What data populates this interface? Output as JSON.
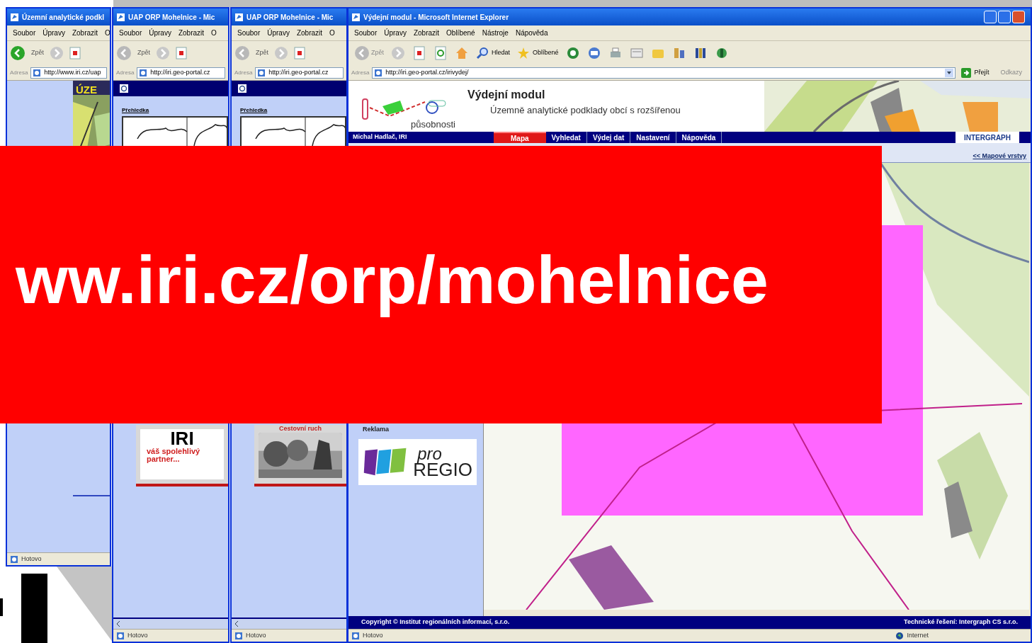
{
  "banner": {
    "text": "ww.iri.cz/orp/mohelnice"
  },
  "windows": [
    {
      "kind": "image_page",
      "image_text": "ÚZE",
      "title": "Územní analytické podkl",
      "menu": [
        "Soubor",
        "Úpravy",
        "Zobrazit",
        "O"
      ],
      "back": "Zpět",
      "address_label": "Adresa",
      "url": "http://www.iri.cz/uap",
      "status": "Hotovo"
    },
    {
      "kind": "overview",
      "title": "UAP ORP Mohelnice - Mic",
      "menu": [
        "Soubor",
        "Úpravy",
        "Zobrazit",
        "O"
      ],
      "back": "Zpět",
      "address_label": "Adresa",
      "url": "http://iri.geo-portal.cz",
      "status": "Hotovo",
      "section": "Přehledka",
      "card": {
        "kind": "logo",
        "brand": "IRI",
        "tagline": "váš spolehlivý partner..."
      }
    },
    {
      "kind": "overview",
      "title": "UAP ORP Mohelnice - Mic",
      "menu": [
        "Soubor",
        "Úpravy",
        "Zobrazit",
        "O"
      ],
      "back": "Zpět",
      "address_label": "Adresa",
      "url": "http://iri.geo-portal.cz",
      "status": "Hotovo",
      "section": "Přehledka",
      "card": {
        "caption": "Cestovní ruch"
      }
    }
  ],
  "main": {
    "title": "Výdejní modul - Microsoft Internet Explorer",
    "menu": [
      "Soubor",
      "Úpravy",
      "Zobrazit",
      "Oblíbené",
      "Nástroje",
      "Nápověda"
    ],
    "back": "Zpět",
    "search": "Hledat",
    "favorites": "Oblíbené",
    "address_label": "Adresa",
    "url": "http://iri.geo-portal.cz/irivydej/",
    "go": "Přejít",
    "links": "Odkazy",
    "header": {
      "title": "Výdejní modul",
      "subtitle": "Územně analytické podklady obcí s rozšířenou",
      "subtitle_2": "působnosti"
    },
    "user": "Michal Hadlač, IRI",
    "tabs": [
      {
        "label": "Mapa",
        "selected": true
      },
      {
        "label": "Vyhledat",
        "selected": false
      },
      {
        "label": "Výdej dat",
        "selected": false
      },
      {
        "label": "Nastavení",
        "selected": false
      },
      {
        "label": "Nápověda",
        "selected": false
      }
    ],
    "partner": "INTERGRAPH",
    "layers_link": "<< Mapové vrstvy",
    "sidebar_heading": "Reklama",
    "ad": {
      "line_1": "pro",
      "line_2": "REGIO"
    },
    "footer_left": "Copyright © Institut regionálních informací, s.r.o.",
    "footer_right": "Technické řešení: Intergraph CS s.r.o.",
    "status": "Hotovo",
    "zone": "Internet"
  }
}
